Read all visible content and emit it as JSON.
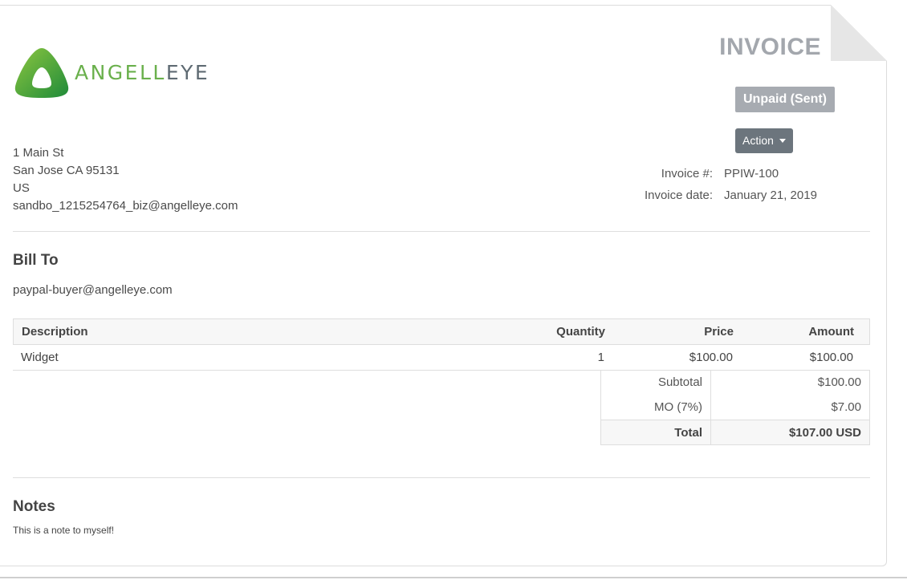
{
  "header": {
    "logo": {
      "text_green": "ANGELL",
      "text_gray": "EYE"
    },
    "title": "INVOICE",
    "status": "Unpaid (Sent)",
    "action_label": "Action"
  },
  "merchant": {
    "address_line1": "1 Main St",
    "address_line2": "San Jose CA 95131",
    "country": "US",
    "email": "sandbo_1215254764_biz@angelleye.com"
  },
  "meta": {
    "invoice_number_label": "Invoice #:",
    "invoice_number": "PPIW-100",
    "invoice_date_label": "Invoice date:",
    "invoice_date": "January 21, 2019"
  },
  "bill_to": {
    "heading": "Bill To",
    "email": "paypal-buyer@angelleye.com"
  },
  "items": {
    "columns": [
      "Description",
      "Quantity",
      "Price",
      "Amount"
    ],
    "rows": [
      {
        "description": "Widget",
        "quantity": "1",
        "price": "$100.00",
        "amount": "$100.00"
      }
    ]
  },
  "totals": {
    "subtotal_label": "Subtotal",
    "subtotal": "$100.00",
    "tax_label": "MO (7%)",
    "tax": "$7.00",
    "total_label": "Total",
    "total": "$107.00 USD"
  },
  "notes": {
    "heading": "Notes",
    "text": "This is a note to myself!"
  },
  "colors": {
    "brand_green": "#6ab04c",
    "badge_gray": "#a7abb1",
    "button_gray": "#6c757d"
  }
}
